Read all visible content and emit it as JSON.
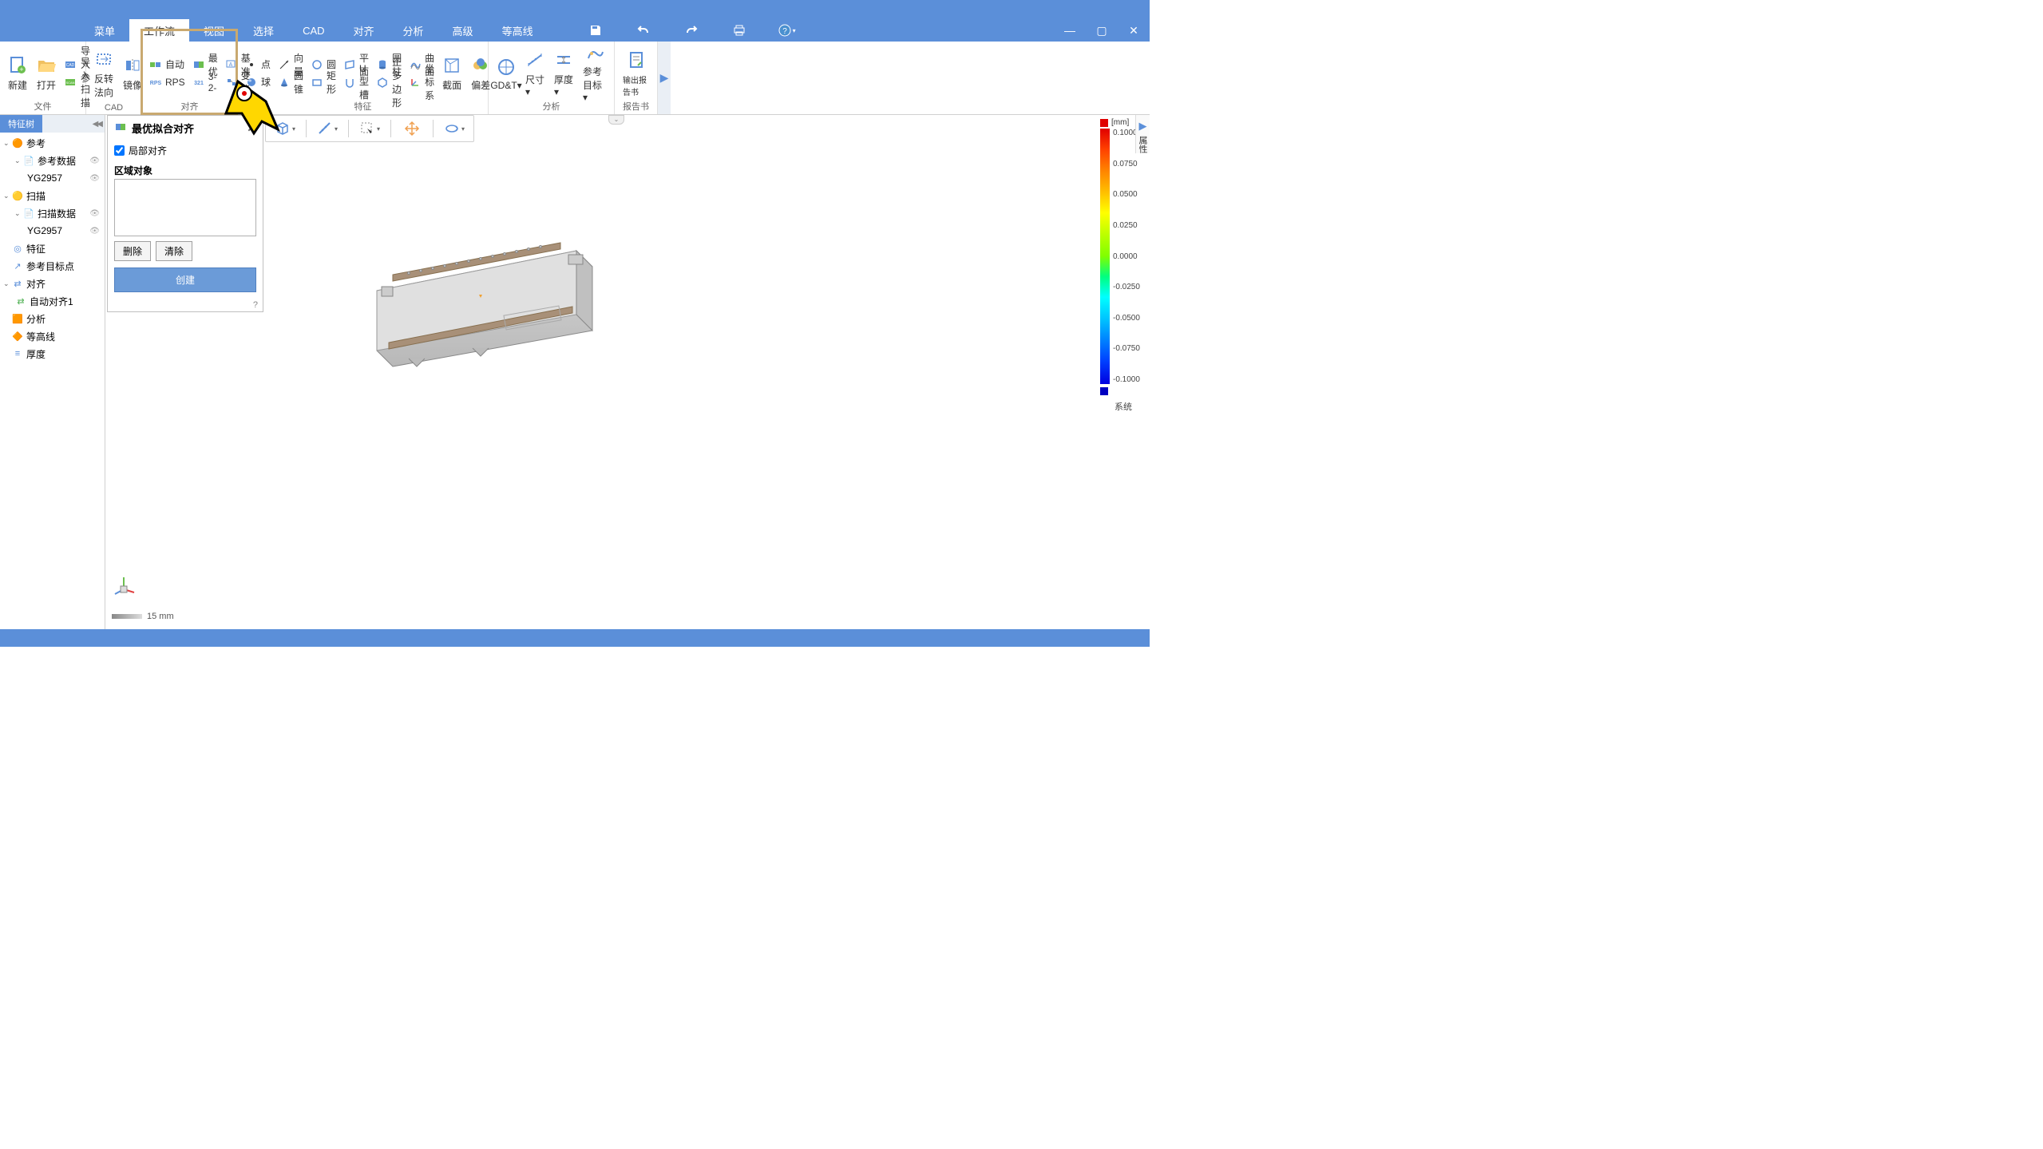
{
  "menubar": {
    "items": [
      "菜单",
      "工作流",
      "视图",
      "选择",
      "CAD",
      "对齐",
      "分析",
      "高级",
      "等高线"
    ],
    "active_index": 1
  },
  "ribbon": {
    "groups": {
      "file": {
        "label": "文件",
        "new": "新建",
        "open": "打开",
        "import_ref": "导入参",
        "import_scan": "导入扫描"
      },
      "cad": {
        "label": "CAD",
        "flip": "反转法向",
        "mirror": "镜像"
      },
      "align": {
        "label": "对齐",
        "auto": "自动",
        "bestfit": "最优",
        "datum": "基准",
        "rps": "RPS",
        "three21": "3-2-",
        "transform": "变换"
      },
      "feature": {
        "label": "特征",
        "point": "点",
        "vector": "向量",
        "circle": "圆",
        "plane": "平面",
        "cylinder": "圆柱",
        "surface": "曲面",
        "sphere": "球",
        "cone": "圆锥",
        "rect": "矩形",
        "uslot": "U型槽",
        "polygon": "正多边形",
        "csys": "坐标系",
        "section": "截面",
        "offset": "偏差"
      },
      "analysis": {
        "label": "分析",
        "gdt": "GD&T",
        "dim": "尺寸",
        "thickness": "厚度",
        "reftarget": "参考目标"
      },
      "report": {
        "label": "报告书",
        "output": "输出报告书"
      }
    }
  },
  "tree": {
    "tab": "特征树",
    "nodes": {
      "ref": "参考",
      "ref_data": "参考数据",
      "ref_item": "YG2957",
      "scan": "扫描",
      "scan_data": "扫描数据",
      "scan_item": "YG2957",
      "feature": "特征",
      "ref_target": "参考目标点",
      "align": "对齐",
      "auto_align1": "自动对齐1",
      "analysis": "分析",
      "contour": "等高线",
      "thickness": "厚度"
    }
  },
  "dialog": {
    "title": "最优拟合对齐",
    "local_check": "局部对齐",
    "region_label": "区域对象",
    "delete": "删除",
    "clear": "清除",
    "create": "创建"
  },
  "scale": {
    "value": "15 mm"
  },
  "legend": {
    "unit": "[mm]",
    "ticks": [
      "0.1000",
      "0.0750",
      "0.0500",
      "0.0250",
      "0.0000",
      "-0.0250",
      "-0.0500",
      "-0.0750",
      "-0.1000"
    ],
    "system": "系统"
  },
  "right_panel": {
    "label": "属性"
  }
}
